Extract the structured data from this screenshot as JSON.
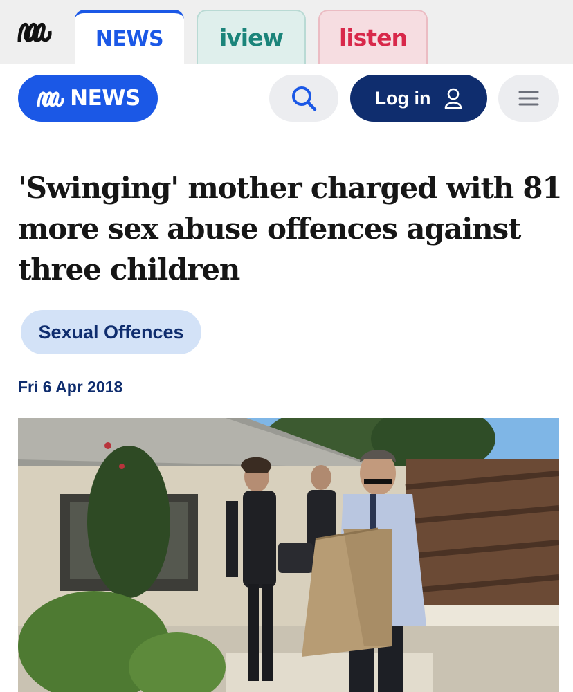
{
  "network_tabs": [
    {
      "label": "NEWS",
      "active": true,
      "color": "#1b58e6"
    },
    {
      "label": "iview",
      "active": false,
      "color": "#1b847a"
    },
    {
      "label": "listen",
      "active": false,
      "color": "#d8284a"
    }
  ],
  "header": {
    "logo_text": "NEWS",
    "search_icon": "search-icon",
    "login_label": "Log in",
    "login_icon": "user-icon",
    "menu_icon": "hamburger-menu-icon"
  },
  "article": {
    "headline": "'Swinging' mother charged with 81 more sex abuse offences against three children",
    "topic": "Sexual Offences",
    "date": "Fri 6 Apr 2018"
  },
  "colors": {
    "brand_blue": "#1b58e6",
    "navy": "#0f2d6e",
    "pill_bg": "#d3e2f7"
  }
}
